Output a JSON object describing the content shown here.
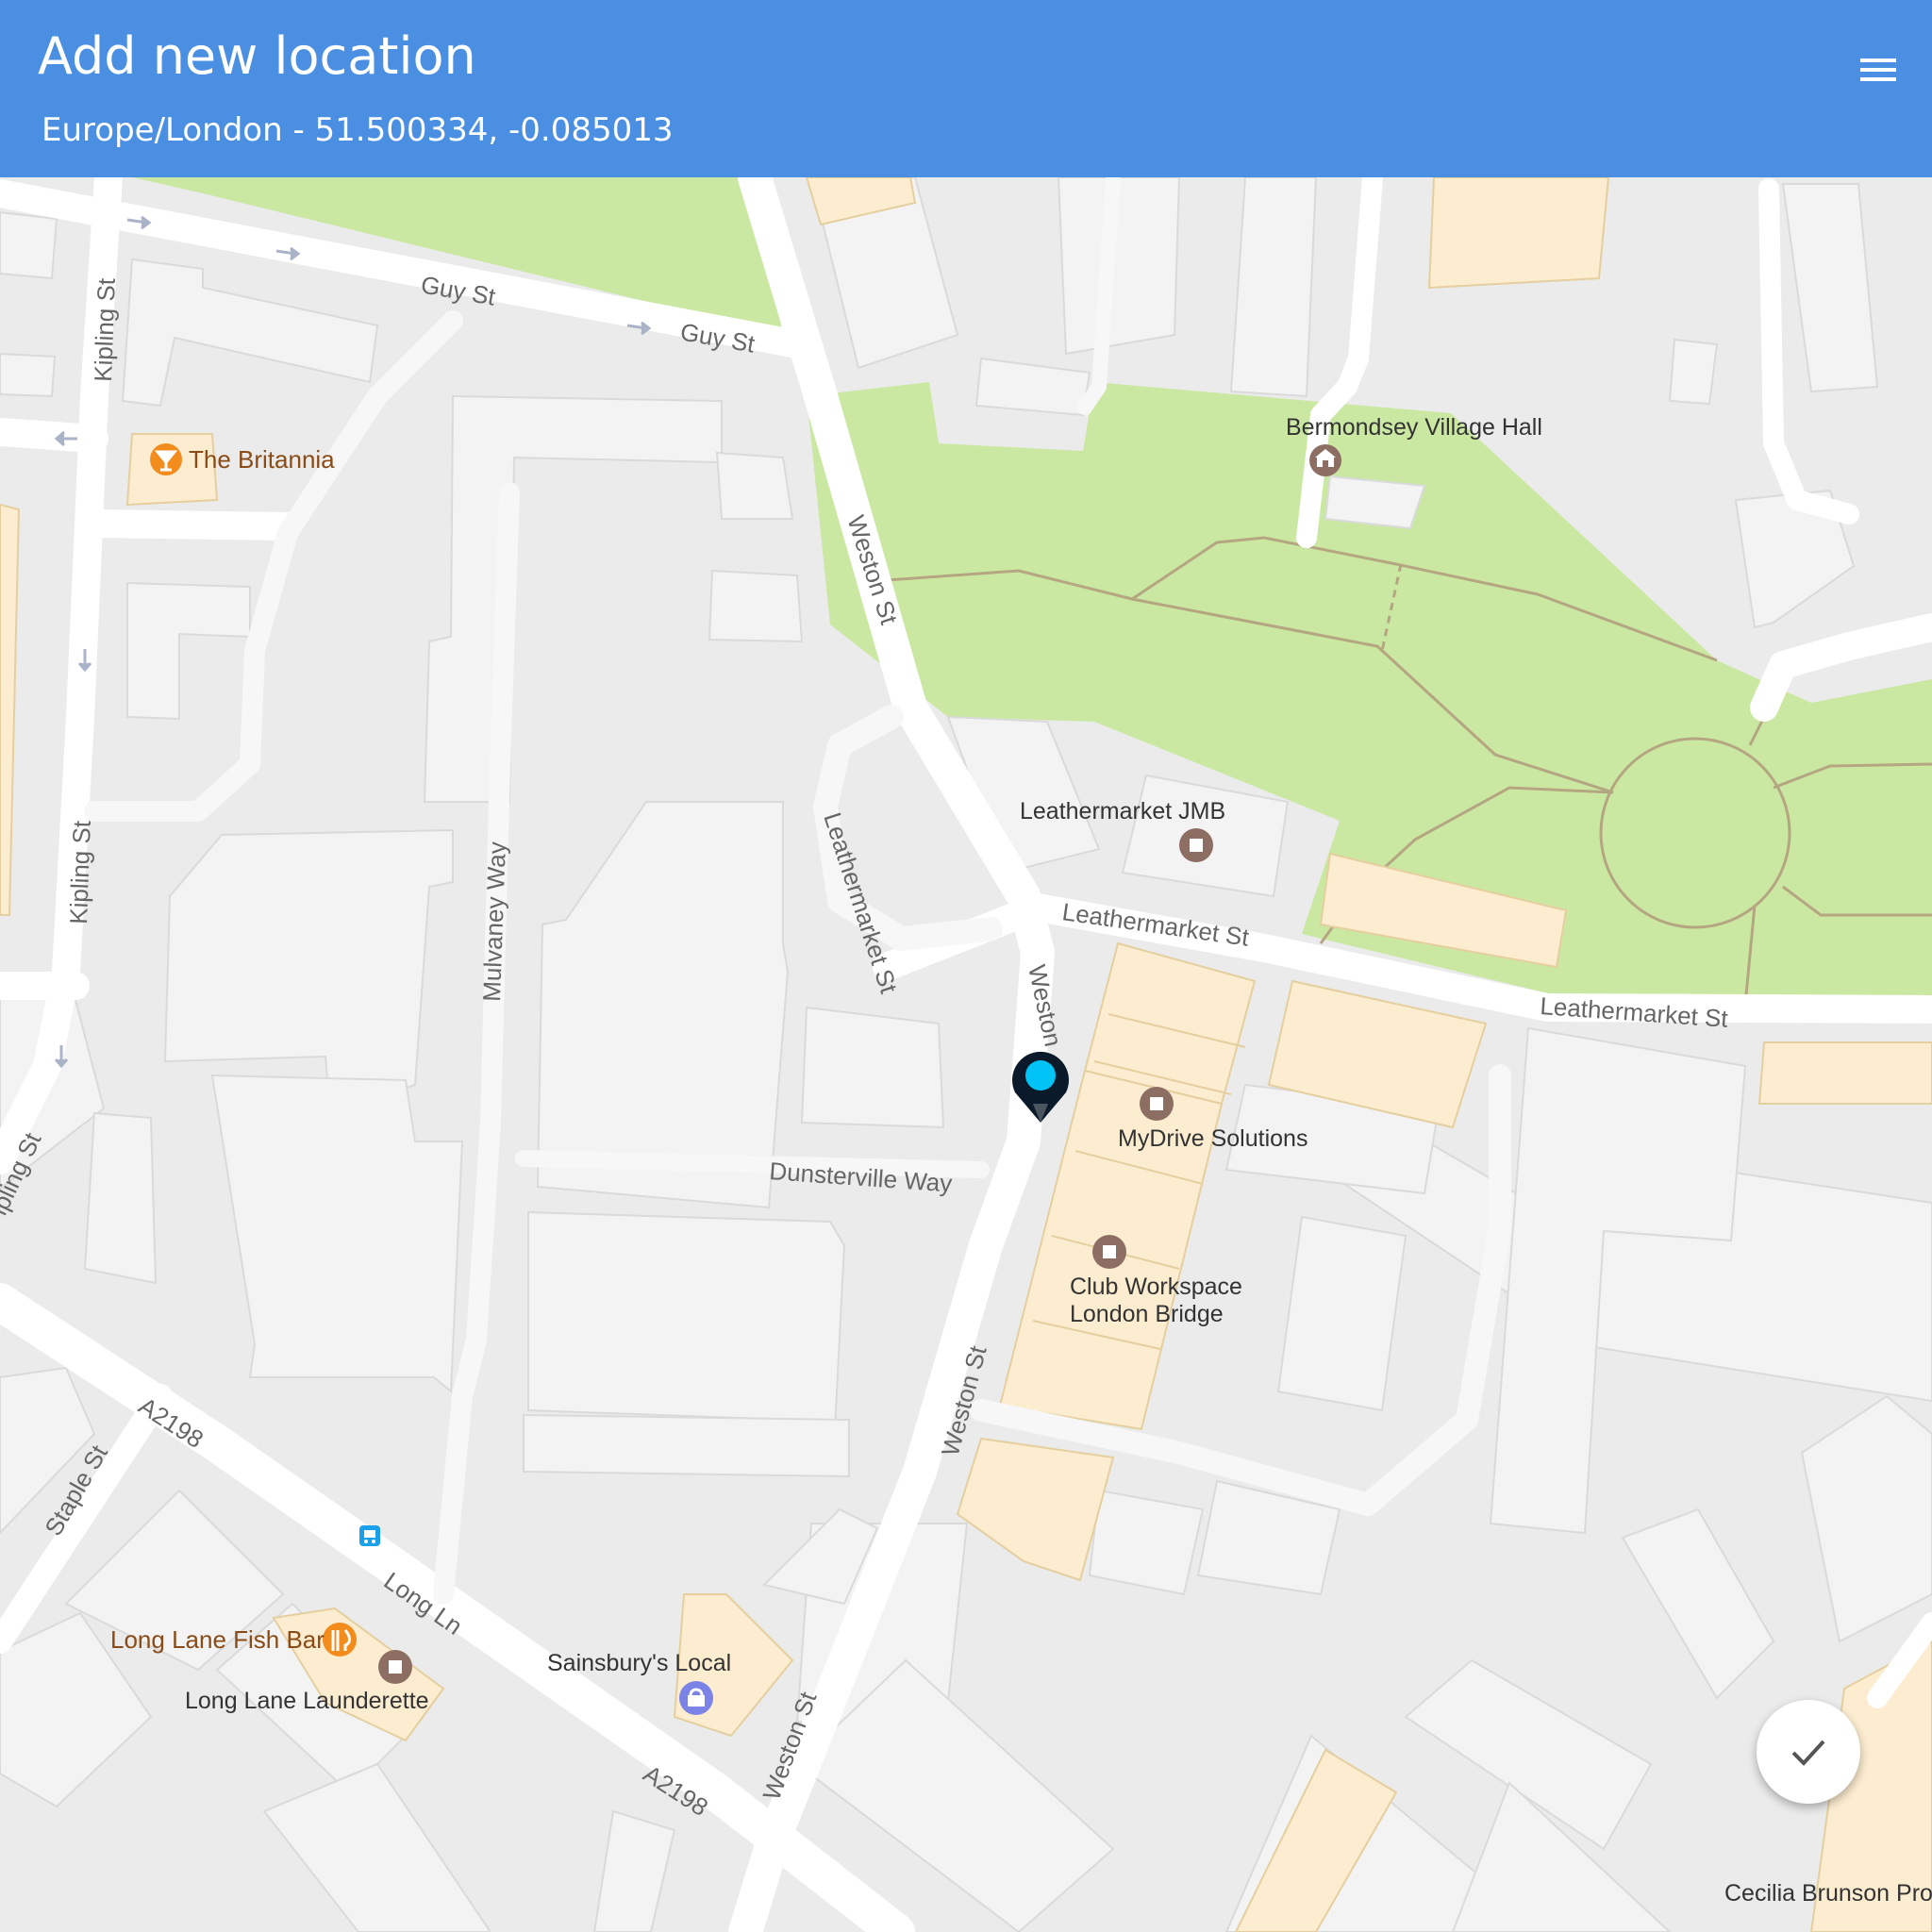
{
  "header": {
    "title": "Add new location",
    "subtitle": "Europe/London - 51.500334, -0.085013",
    "menu_icon": "hamburger-icon"
  },
  "colors": {
    "appbar": "#4a8fe2",
    "park": "#cbe8a3",
    "building": "#f3f3f3",
    "commercial": "#fcecd0",
    "marker": "#0a1a2b",
    "marker_dot": "#00c4f6"
  },
  "map": {
    "places": {
      "britannia": "The Britannia",
      "village_hall": "Bermondsey Village Hall",
      "leathermarket_jmb": "Leathermarket JMB",
      "mydrive": "MyDrive Solutions",
      "club_workspace_1": "Club Workspace",
      "club_workspace_2": "London Bridge",
      "fish_bar": "Long Lane Fish Bar",
      "launderette": "Long Lane Launderette",
      "sainsburys": "Sainsbury's Local",
      "cecilia": "Cecilia Brunson Pro"
    },
    "roads": {
      "guy_st": "Guy St",
      "kipling_st": "Kipling St",
      "weston_st": "Weston St",
      "weston_short": "Weston",
      "leathermarket_st": "Leathermarket St",
      "mulvaney_way": "Mulvaney Way",
      "dunsterville_way": "Dunsterville Way",
      "a2198": "A2198",
      "long_ln": "Long Ln",
      "staple_st": "Staple St",
      "kipling_cut": "ipling St"
    },
    "icons": [
      "bar-icon",
      "town-hall-icon",
      "business-icon",
      "restaurant-icon",
      "shopping-icon",
      "bus-stop-icon",
      "location-pin-icon"
    ]
  },
  "actions": {
    "confirm_icon": "check-icon"
  }
}
